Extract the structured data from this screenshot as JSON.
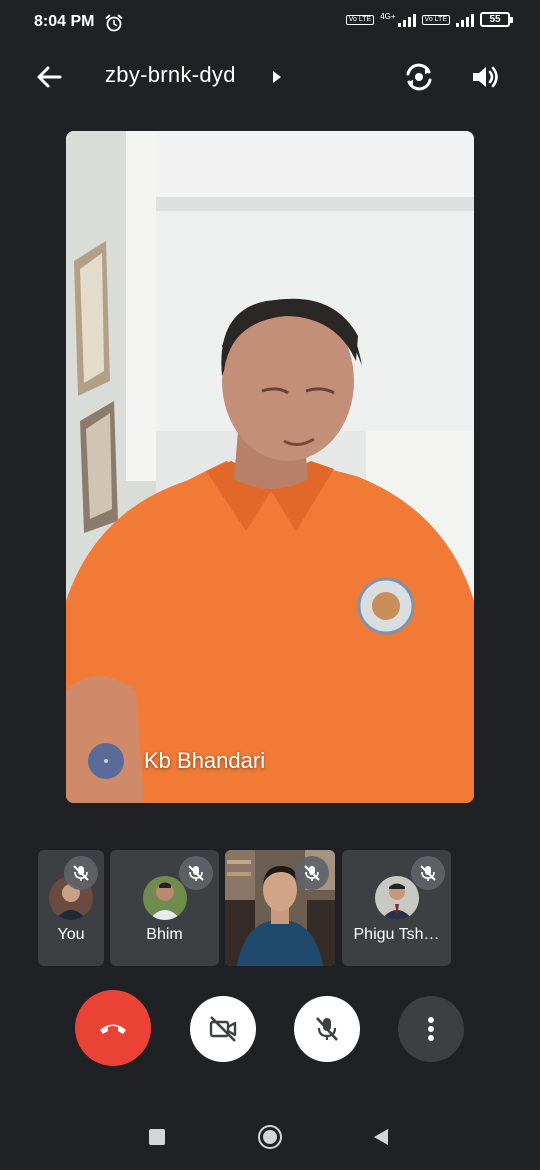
{
  "status_bar": {
    "time": "8:04 PM",
    "alarm_icon": "alarm-clock-icon",
    "volte_1": "Vo LTE",
    "network_type": "4G+",
    "volte_2": "Vo LTE",
    "battery": "55"
  },
  "header": {
    "back_icon": "arrow-left-icon",
    "meeting_code": "zby-brnk-dyd",
    "caret_icon": "caret-right-icon",
    "switch_camera_icon": "camera-switch-icon",
    "audio_icon": "speaker-icon"
  },
  "main_video": {
    "participant_name": "Kb Bhandari",
    "shirt_color": "#f07a36"
  },
  "participants": [
    {
      "label": "You",
      "muted": true
    },
    {
      "label": "Bhim",
      "muted": true
    },
    {
      "label": "",
      "muted": true
    },
    {
      "label": "Phigu Tsh…",
      "muted": true
    }
  ],
  "controls": {
    "end_call_icon": "phone-hangup-icon",
    "camera_icon": "video-off-icon",
    "mic_icon": "mic-off-icon",
    "more_icon": "more-vert-icon",
    "end_call_color": "#ea4335"
  },
  "nav": {
    "recents_icon": "square-icon",
    "home_icon": "circle-icon",
    "back_icon": "triangle-back-icon"
  }
}
